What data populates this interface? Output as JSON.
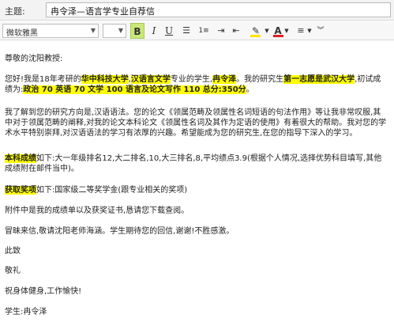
{
  "subject": {
    "label": "主题:",
    "value": "冉令泽—语言学专业自荐信"
  },
  "toolbar": {
    "font_family": "微软雅黑",
    "font_size": "",
    "bold": "B",
    "italic": "I",
    "underline": "U",
    "bullet_list_icon": "bullet-list-icon",
    "numbered_list_icon": "numbered-list-icon",
    "indent_icon": "indent-icon",
    "outdent_icon": "outdent-icon",
    "highlight_icon": "highlighter-icon",
    "font_color": "A",
    "align_icon": "align-icon",
    "more_icon": "chevron-double-down-icon",
    "highlight_color": "#ffe500",
    "font_color_value": "#e02020",
    "bold_active_bg": "#c9e878"
  },
  "letter": {
    "greeting": "尊敬的沈阳教授:",
    "p1": {
      "t1": "您好!我是18年考研的",
      "h1": "华中科技大学",
      "t2": ",",
      "h2": "汉语言文学",
      "t3": "专业的学生,",
      "h3": "冉令泽",
      "t4": "。我的研究生",
      "h4": "第一志愿是武汉大学",
      "t5": ",初试成绩为:",
      "h5": "政治 70 英语 70 文学 100 语言及论文写作 110 总分:350分",
      "t6": "。"
    },
    "p2": "我了解到您的研究方向是,汉语语法。您的论文《领属范畴及领属性名词短语的句法作用》等让我非常叹服,其中对于领属范畴的阐释,对我的论文本科论文《领属性名词及其作为定语的使用》有着很大的帮助。我对您的学术水平特别崇拜,对汉语语法的学习有浓厚的兴趣。希望能成为您的研究生,在您的指导下深入的学习。",
    "p3": {
      "h": "本科成绩",
      "t": "如下:大一年级排名12,大二排名,10,大三排名,8,平均绩点3.9(根据个人情况,选择优势科目填写,其他成绩附在邮件当中)。"
    },
    "p4": {
      "h": "获取奖项",
      "t": "如下:国家级二等奖学金(跟专业相关的奖项)"
    },
    "p5": "附件中是我的成绩单以及获奖证书,恳请您下载查阅。",
    "p6": "冒昧来信,敬请沈阳老师海涵。学生期待您的回信,谢谢!不胜感激。",
    "closing1": "此致",
    "closing2": "敬礼",
    "wish": "祝身体健身,工作愉快!",
    "signature": "学生:冉令泽"
  }
}
